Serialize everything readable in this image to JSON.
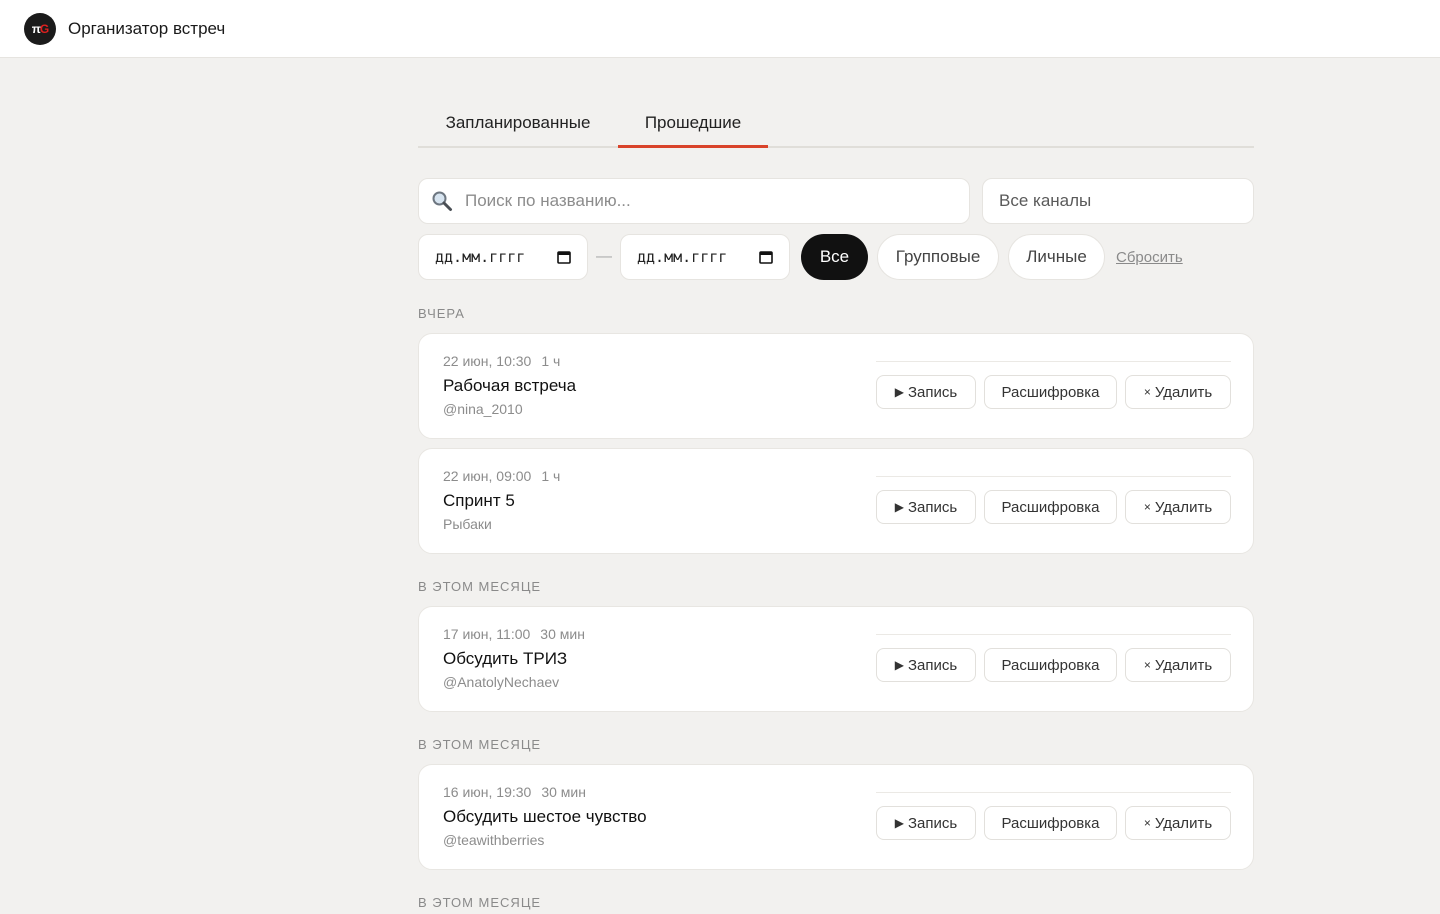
{
  "app": {
    "logo_text": "πG",
    "title": "Организатор встреч"
  },
  "tabs": [
    {
      "label": "Запланированные",
      "active": false
    },
    {
      "label": "Прошедшие",
      "active": true
    }
  ],
  "filters": {
    "search_placeholder": "Поиск по названию...",
    "channel_select": "Все каналы",
    "date_from_placeholder": "дд.мм.гггг",
    "date_to_placeholder": "дд.мм.гггг",
    "date_separator": "—",
    "type_pills": [
      "Все",
      "Групповые",
      "Личные"
    ],
    "active_pill": "Все",
    "reset_label": "Сбросить"
  },
  "actions": {
    "record": "Запись",
    "transcript": "Расшифровка",
    "delete": "Удалить"
  },
  "groups": [
    {
      "label": "ВЧЕРА",
      "meetings": [
        {
          "when": "22 июн, 10:30",
          "duration": "1 ч",
          "title": "Рабочая встреча",
          "channel": "@nina_2010"
        },
        {
          "when": "22 июн, 09:00",
          "duration": "1 ч",
          "title": "Спринт 5",
          "channel": "Рыбаки"
        }
      ]
    },
    {
      "label": "В ЭТОМ МЕСЯЦЕ",
      "meetings": [
        {
          "when": "17 июн, 11:00",
          "duration": "30 мин",
          "title": "Обсудить ТРИЗ",
          "channel": "@AnatolyNechaev"
        }
      ]
    },
    {
      "label": "В ЭТОМ МЕСЯЦЕ",
      "meetings": [
        {
          "when": "16 июн, 19:30",
          "duration": "30 мин",
          "title": "Обсудить шестое чувство",
          "channel": "@teawithberries"
        }
      ]
    },
    {
      "label": "В ЭТОМ МЕСЯЦЕ",
      "meetings": []
    }
  ],
  "colors": {
    "accent": "#d9432a",
    "active_pill": "#111111",
    "background": "#f2f1ef"
  }
}
